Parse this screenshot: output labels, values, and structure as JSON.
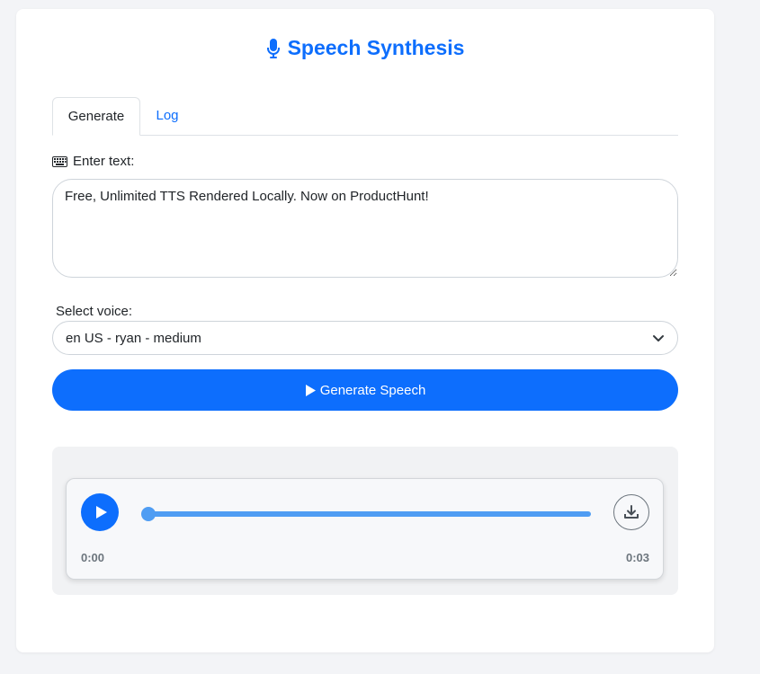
{
  "app": {
    "title": "Speech Synthesis",
    "accent_color": "#0d6efd",
    "title_icon": "microphone-icon"
  },
  "tabs": [
    {
      "label": "Generate",
      "active": true
    },
    {
      "label": "Log",
      "active": false
    }
  ],
  "text_input": {
    "label": "Enter text:",
    "icon": "keyboard-icon",
    "value": "Free, Unlimited TTS Rendered Locally. Now on ProductHunt!"
  },
  "voice_select": {
    "label": "Select voice:",
    "selected": "en US - ryan - medium"
  },
  "generate_button": {
    "label": "Generate Speech",
    "icon": "play-icon"
  },
  "audio_player": {
    "current_time": "0:00",
    "duration": "0:03",
    "progress_fraction": 0.0,
    "play_icon": "play-icon",
    "download_icon": "download-icon"
  }
}
